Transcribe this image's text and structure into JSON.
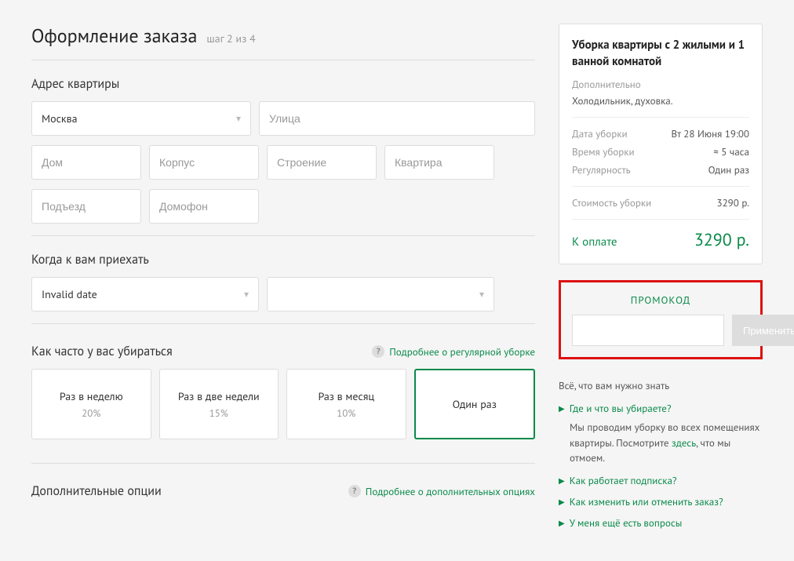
{
  "header": {
    "title": "Оформление заказа",
    "step": "шаг 2 из 4"
  },
  "address": {
    "section_title": "Адрес квартиры",
    "city": "Москва",
    "street_ph": "Улица",
    "house_ph": "Дом",
    "block_ph": "Корпус",
    "building_ph": "Строение",
    "apt_ph": "Квартира",
    "entrance_ph": "Подъезд",
    "intercom_ph": "Домофон"
  },
  "datetime": {
    "section_title": "Когда к вам приехать",
    "date_value": "Invalid date",
    "time_value": ""
  },
  "frequency": {
    "section_title": "Как часто у вас убираться",
    "help": "Подробнее о регулярной уборке",
    "options": [
      {
        "label": "Раз в неделю",
        "discount": "20%"
      },
      {
        "label": "Раз в две недели",
        "discount": "15%"
      },
      {
        "label": "Раз в месяц",
        "discount": "10%"
      },
      {
        "label": "Один раз",
        "discount": ""
      }
    ],
    "selected_index": 3
  },
  "extras_section": {
    "section_title": "Дополнительные опции",
    "help": "Подробнее о дополнительных опциях"
  },
  "summary": {
    "title": "Уборка квартиры с 2 жилыми и 1 ванной комнатой",
    "addl_label": "Дополнительно",
    "addl_text": "Холодильник, духовка.",
    "date_label": "Дата уборки",
    "date_value": "Вт 28 Июня 19:00",
    "duration_label": "Время уборки",
    "duration_value": "≈ 5 часа",
    "regularity_label": "Регулярность",
    "regularity_value": "Один раз",
    "cost_label": "Стоимость уборки",
    "cost_value": "3290 р.",
    "total_label": "К оплате",
    "total_value": "3290 р."
  },
  "promo": {
    "title": "ПРОМОКОД",
    "apply": "Применить"
  },
  "faq": {
    "header": "Всё, что вам нужно знать",
    "items": [
      {
        "q": "Где и что вы убираете?",
        "a_pre": "Мы проводим уборку во всех помещениях квартиры. Посмотрите ",
        "a_link": "здесь",
        "a_post": ", что мы отмоем.",
        "expanded": true
      },
      {
        "q": "Как работает подписка?",
        "expanded": false
      },
      {
        "q": "Как изменить или отменить заказ?",
        "expanded": false
      },
      {
        "q": "У меня ещё есть вопросы",
        "expanded": false
      }
    ]
  }
}
